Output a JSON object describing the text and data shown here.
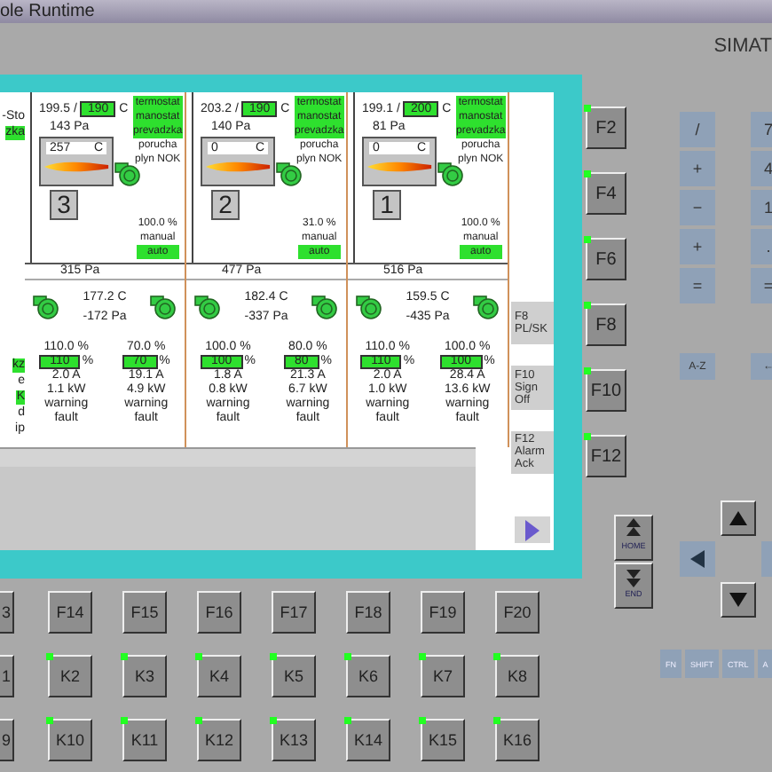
{
  "window": {
    "title": "ole Runtime"
  },
  "brand": "SIMAT",
  "screen": {
    "left_edge_top": [
      {
        "text": "-Sto",
        "active": false
      },
      {
        "text": "zka",
        "active": true
      }
    ],
    "left_edge_bottom": [
      {
        "text": "kz",
        "active": true
      },
      {
        "text": "e",
        "active": false
      },
      {
        "text": "K",
        "active": true
      },
      {
        "text": "d",
        "active": false
      },
      {
        "text": "ip",
        "active": false
      }
    ],
    "units": [
      {
        "number": "3",
        "temperature": "199.5",
        "separator": "/",
        "setpoint": "190",
        "temperature_unit": "C",
        "chamber_pressure": "143 Pa",
        "burner_temperature": "257",
        "burner_unit": "C",
        "statuses": [
          {
            "text": "termostat",
            "active": true
          },
          {
            "text": "manostat",
            "active": true
          },
          {
            "text": "prevadzka",
            "active": true
          },
          {
            "text": "porucha",
            "active": false
          },
          {
            "text": "plyn NOK",
            "active": false
          }
        ],
        "output": "100.0 %",
        "mode": "manual",
        "auto": {
          "text": "auto",
          "active": true
        },
        "header_pressure": "315 Pa",
        "air_temperature": "177.2 C",
        "air_pressure": "-172 Pa",
        "fans": [
          {
            "actual": "110.0 %",
            "setpoint": "110",
            "setpoint_unit": "%",
            "current": "2.0 A",
            "power": "1.1 kW",
            "warning": "warning",
            "fault": "fault"
          },
          {
            "actual": "70.0 %",
            "setpoint": "70",
            "setpoint_unit": "%",
            "current": "19.1 A",
            "power": "4.9 kW",
            "warning": "warning",
            "fault": "fault"
          }
        ]
      },
      {
        "number": "2",
        "temperature": "203.2",
        "separator": "/",
        "setpoint": "190",
        "temperature_unit": "C",
        "chamber_pressure": "140 Pa",
        "burner_temperature": "0",
        "burner_unit": "C",
        "statuses": [
          {
            "text": "termostat",
            "active": true
          },
          {
            "text": "manostat",
            "active": true
          },
          {
            "text": "prevadzka",
            "active": true
          },
          {
            "text": "porucha",
            "active": false
          },
          {
            "text": "plyn NOK",
            "active": false
          }
        ],
        "output": "31.0 %",
        "mode": "manual",
        "auto": {
          "text": "auto",
          "active": true
        },
        "header_pressure": "477 Pa",
        "air_temperature": "182.4 C",
        "air_pressure": "-337 Pa",
        "fans": [
          {
            "actual": "100.0 %",
            "setpoint": "100",
            "setpoint_unit": "%",
            "current": "1.8 A",
            "power": "0.8 kW",
            "warning": "warning",
            "fault": "fault"
          },
          {
            "actual": "80.0 %",
            "setpoint": "80",
            "setpoint_unit": "%",
            "current": "21.3 A",
            "power": "6.7 kW",
            "warning": "warning",
            "fault": "fault"
          }
        ]
      },
      {
        "number": "1",
        "temperature": "199.1",
        "separator": "/",
        "setpoint": "200",
        "temperature_unit": "C",
        "chamber_pressure": "81 Pa",
        "burner_temperature": "0",
        "burner_unit": "C",
        "statuses": [
          {
            "text": "termostat",
            "active": true
          },
          {
            "text": "manostat",
            "active": true
          },
          {
            "text": "prevadzka",
            "active": true
          },
          {
            "text": "porucha",
            "active": false
          },
          {
            "text": "plyn NOK",
            "active": false
          }
        ],
        "output": "100.0 %",
        "mode": "manual",
        "auto": {
          "text": "auto",
          "active": true
        },
        "header_pressure": "516 Pa",
        "air_temperature": "159.5 C",
        "air_pressure": "-435 Pa",
        "fans": [
          {
            "actual": "110.0 %",
            "setpoint": "110",
            "setpoint_unit": "%",
            "current": "2.0 A",
            "power": "1.0 kW",
            "warning": "warning",
            "fault": "fault"
          },
          {
            "actual": "100.0 %",
            "setpoint": "100",
            "setpoint_unit": "%",
            "current": "28.4 A",
            "power": "13.6 kW",
            "warning": "warning",
            "fault": "fault"
          }
        ]
      }
    ],
    "softkeys": [
      {
        "key": "F8",
        "label": "PL/SK"
      },
      {
        "key": "F10",
        "label": "Sign Off"
      },
      {
        "key": "F12",
        "label": "Alarm Ack"
      }
    ]
  },
  "side_keys": [
    {
      "label": "F2",
      "led": true
    },
    {
      "label": "F4",
      "led": true
    },
    {
      "label": "F6",
      "led": true
    },
    {
      "label": "F8",
      "led": true
    },
    {
      "label": "F10",
      "led": true
    },
    {
      "label": "F12",
      "led": true
    }
  ],
  "navigation_keys": [
    "HOME",
    "END"
  ],
  "bottom_keys": [
    [
      {
        "label": "3"
      },
      {
        "label": "F14",
        "led": false
      },
      {
        "label": "F15",
        "led": false
      },
      {
        "label": "F16",
        "led": false
      },
      {
        "label": "F17",
        "led": false
      },
      {
        "label": "F18",
        "led": false
      },
      {
        "label": "F19",
        "led": false
      },
      {
        "label": "F20",
        "led": false
      }
    ],
    [
      {
        "label": "1"
      },
      {
        "label": "K2",
        "led": true
      },
      {
        "label": "K3",
        "led": true
      },
      {
        "label": "K4",
        "led": true
      },
      {
        "label": "K5",
        "led": true
      },
      {
        "label": "K6",
        "led": true
      },
      {
        "label": "K7",
        "led": true
      },
      {
        "label": "K8",
        "led": true
      }
    ],
    [
      {
        "label": "9"
      },
      {
        "label": "K10",
        "led": true
      },
      {
        "label": "K11",
        "led": true
      },
      {
        "label": "K12",
        "led": true
      },
      {
        "label": "K13",
        "led": true
      },
      {
        "label": "K14",
        "led": true
      },
      {
        "label": "K15",
        "led": true
      },
      {
        "label": "K16",
        "led": true
      }
    ]
  ],
  "keypad": [
    "/",
    "7",
    "+",
    "4",
    "−",
    "1",
    "+",
    ".",
    "=",
    "="
  ],
  "keypad_extra": [
    "A-Z",
    "←"
  ],
  "modifier_keys": [
    "FN",
    "SHIFT",
    "CTRL",
    "A"
  ]
}
